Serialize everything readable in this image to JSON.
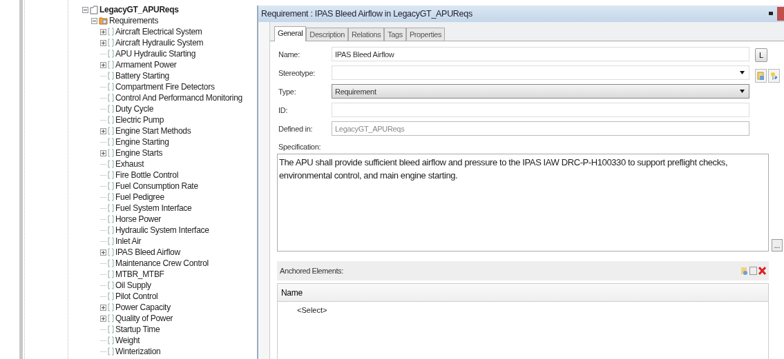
{
  "tree": {
    "label": "LegacyGT_APUReqs",
    "kind": "package",
    "expanded": true,
    "children": [
      {
        "label": "Requirements",
        "kind": "folder",
        "expanded": true,
        "children": [
          {
            "label": "Aircraft Electrical System",
            "kind": "group",
            "expanded": false
          },
          {
            "label": "Aircraft Hydraulic System",
            "kind": "group",
            "expanded": false
          },
          {
            "label": "APU Hydraulic Starting",
            "kind": "leaf"
          },
          {
            "label": "Armament Power",
            "kind": "group",
            "expanded": false
          },
          {
            "label": "Battery Starting",
            "kind": "leaf"
          },
          {
            "label": "Compartment Fire Detectors",
            "kind": "leaf"
          },
          {
            "label": "Control And Performancd Monitoring",
            "kind": "leaf"
          },
          {
            "label": "Duty Cycle",
            "kind": "leaf"
          },
          {
            "label": "Electric Pump",
            "kind": "leaf"
          },
          {
            "label": "Engine Start Methods",
            "kind": "group",
            "expanded": false
          },
          {
            "label": "Engine Starting",
            "kind": "leaf"
          },
          {
            "label": "Engine Starts",
            "kind": "group",
            "expanded": false
          },
          {
            "label": "Exhaust",
            "kind": "leaf"
          },
          {
            "label": "Fire Bottle Control",
            "kind": "leaf"
          },
          {
            "label": "Fuel Consumption Rate",
            "kind": "leaf"
          },
          {
            "label": "Fuel Pedigree",
            "kind": "leaf"
          },
          {
            "label": "Fuel System Interface",
            "kind": "leaf"
          },
          {
            "label": "Horse Power",
            "kind": "leaf"
          },
          {
            "label": "Hydraulic System Interface",
            "kind": "leaf"
          },
          {
            "label": "Inlet Air",
            "kind": "leaf"
          },
          {
            "label": "IPAS Bleed Airflow",
            "kind": "group",
            "expanded": false
          },
          {
            "label": "Maintenance Crew Control",
            "kind": "leaf"
          },
          {
            "label": "MTBR_MTBF",
            "kind": "leaf"
          },
          {
            "label": "Oil Supply",
            "kind": "leaf"
          },
          {
            "label": "Pilot  Control",
            "kind": "leaf"
          },
          {
            "label": "Power Capacity",
            "kind": "group",
            "expanded": false
          },
          {
            "label": "Quality of Power",
            "kind": "group",
            "expanded": false
          },
          {
            "label": "Startup Time",
            "kind": "leaf"
          },
          {
            "label": "Weight",
            "kind": "leaf"
          },
          {
            "label": "Winterization",
            "kind": "leaf"
          }
        ]
      }
    ]
  },
  "panel": {
    "title": "Requirement : IPAS Bleed Airflow in LegacyGT_APUReqs",
    "tabs": [
      {
        "label": "General",
        "selected": true
      },
      {
        "label": "Description",
        "selected": false
      },
      {
        "label": "Relations",
        "selected": false
      },
      {
        "label": "Tags",
        "selected": false
      },
      {
        "label": "Properties",
        "selected": false
      }
    ],
    "fields": [
      {
        "label": "Name:",
        "kind": "text",
        "value": "IPAS Bleed Airflow",
        "disabled": false
      },
      {
        "label": "Stereotype:",
        "kind": "dropdown",
        "disabled": false
      },
      {
        "label": "Type:",
        "kind": "combo",
        "value": "Requirement",
        "disabled": false
      },
      {
        "label": "ID:",
        "kind": "text",
        "disabled": false
      },
      {
        "label": "Defined in:",
        "kind": "text",
        "value": "LegacyGT_APUReqs",
        "disabled": true
      }
    ],
    "l_button": "L",
    "specification_label": "Specification:",
    "specification": "The APU shall provide sufficient bleed airflow and pressure to the IPAS IAW DRC-P-H100330 to support preflight checks, environmental control, and main engine starting.",
    "more_button": "...",
    "anchored": {
      "title": "Anchored Elements:",
      "columns": [
        "Name"
      ],
      "rows": [
        "<Select>"
      ]
    }
  }
}
